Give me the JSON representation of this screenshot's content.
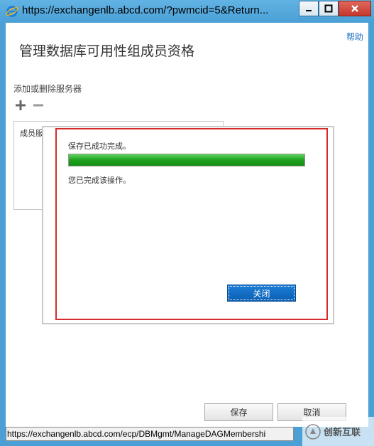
{
  "window": {
    "title": "https://exchangenlb.abcd.com/?pwmcid=5&Return...",
    "accent": "#4a9fd5"
  },
  "page": {
    "help_label": "帮助",
    "title": "管理数据库可用性组成员资格",
    "section_label": "添加或删除服务器",
    "list_header": "成员服"
  },
  "dialog": {
    "status_text": "保存已成功完成。",
    "progress_percent": 100,
    "done_text": "您已完成该操作。",
    "close_label": "关闭",
    "highlight_color": "#d62b2b"
  },
  "footer": {
    "save_label": "保存",
    "cancel_label": "取消"
  },
  "statusbar": {
    "url": "https://exchangenlb.abcd.com/ecp/DBMgmt/ManageDAGMembershi"
  },
  "watermark": {
    "text": "创新互联"
  }
}
